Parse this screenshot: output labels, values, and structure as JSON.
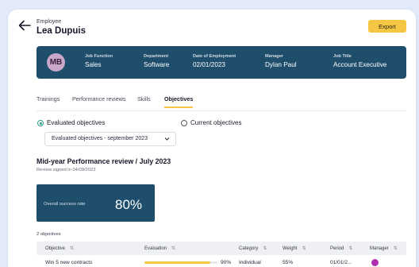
{
  "header": {
    "label": "Employee",
    "name": "Lea Dupuis",
    "export_label": "Export",
    "back_icon": "arrow-left-icon"
  },
  "banner": {
    "avatar_initials": "MB",
    "fields": [
      {
        "label": "Job Function",
        "value": "Sales"
      },
      {
        "label": "Department",
        "value": "Software"
      },
      {
        "label": "Date of Employment",
        "value": "02/01/2023"
      },
      {
        "label": "Manager",
        "value": "Dylan Paul"
      },
      {
        "label": "Job Title",
        "value": "Account Executive"
      }
    ]
  },
  "tabs": [
    {
      "label": "Trainings",
      "active": false
    },
    {
      "label": "Performance reviews",
      "active": false
    },
    {
      "label": "Skills",
      "active": false
    },
    {
      "label": "Objectives",
      "active": true
    }
  ],
  "filters": {
    "evaluated_label": "Evaluated objectives",
    "current_label": "Current objectives",
    "selected": "evaluated",
    "select_value": "Evaluated objectives - september 2023"
  },
  "review": {
    "title": "Mid-year Performance review / July 2023",
    "subtitle": "Review signed in 04/09/2023",
    "kpi_label": "Overall success rate",
    "kpi_value": "80%"
  },
  "objectives": {
    "count_label": "2 objectives",
    "columns": [
      "Objective",
      "Evaluation",
      "Category",
      "Weight",
      "Period",
      "Manager"
    ],
    "rows": [
      {
        "objective": "Win 5 new contracts",
        "evaluation_pct": 90,
        "evaluation_label": "90%",
        "category": "Individual",
        "weight": "55%",
        "period": "01/01/2..."
      }
    ]
  },
  "colors": {
    "accent": "#f5c644",
    "banner": "#1f4e6c",
    "radio_on": "#2b9c8f",
    "background": "#e3ebfa"
  }
}
